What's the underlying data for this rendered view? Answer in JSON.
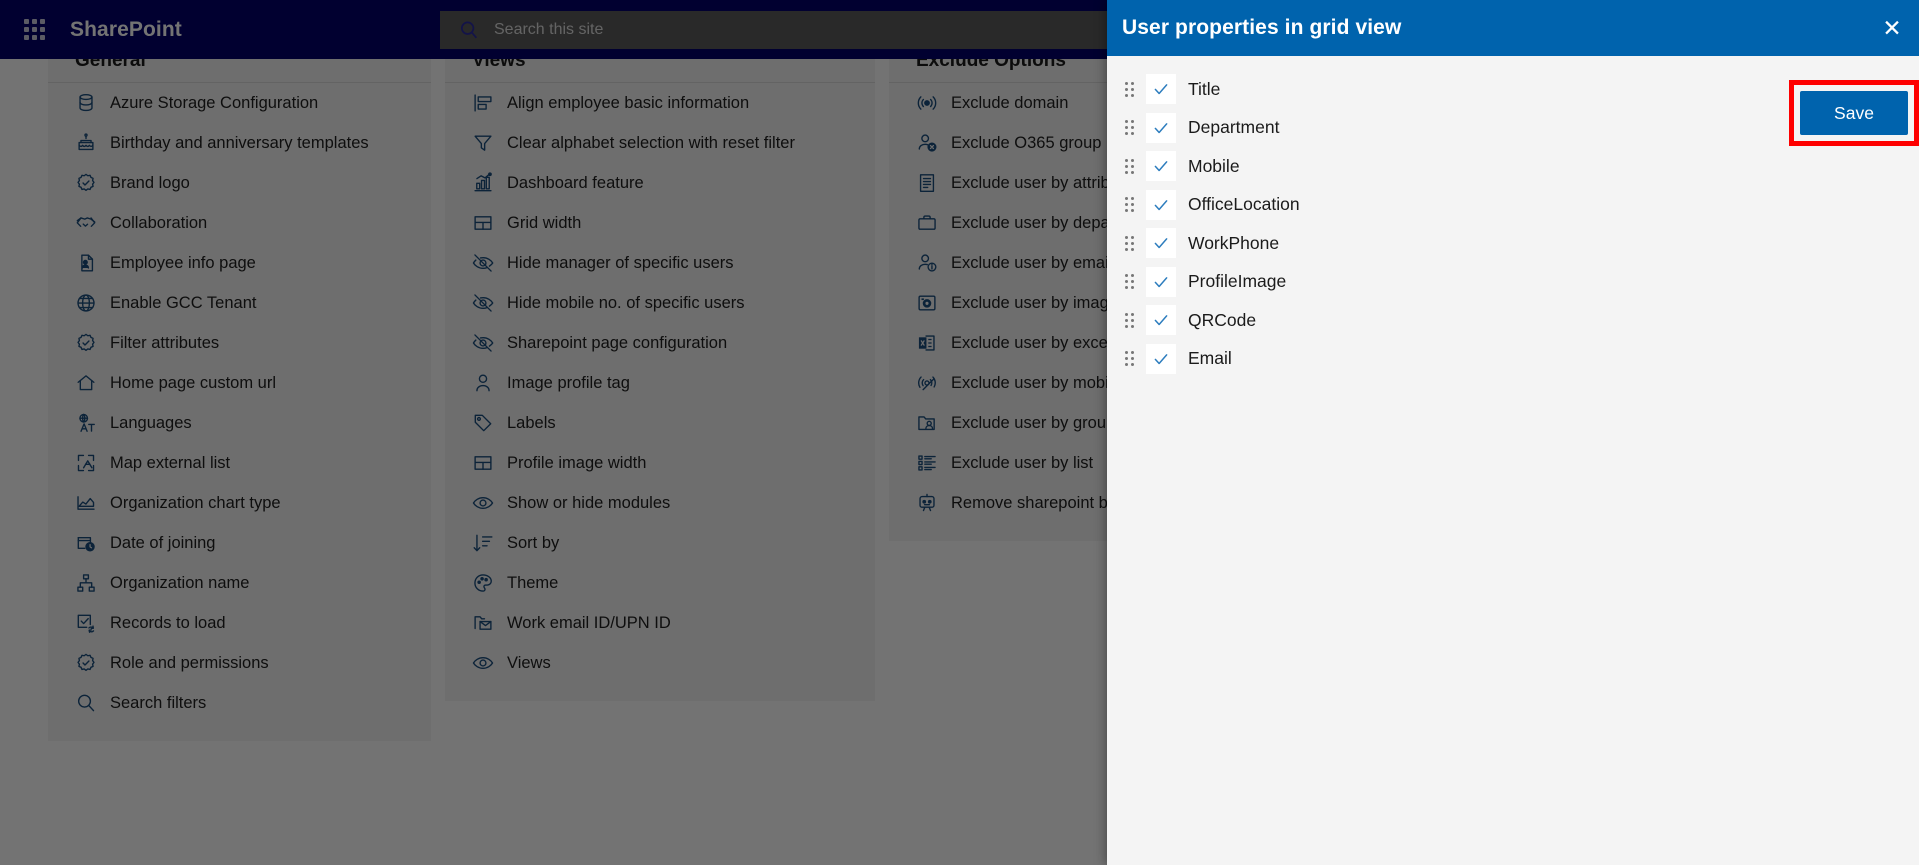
{
  "topbar": {
    "waffle_icon": "app-launcher-icon",
    "brand": "SharePoint",
    "search_icon": "search-icon",
    "search_placeholder": "Search this site",
    "search_value": ""
  },
  "columns": [
    {
      "key": "general",
      "title": "General",
      "items": [
        {
          "label": "Azure Storage Configuration",
          "icon": "database-icon"
        },
        {
          "label": "Birthday and anniversary templates",
          "icon": "cake-icon"
        },
        {
          "label": "Brand logo",
          "icon": "badge-check-icon"
        },
        {
          "label": "Collaboration",
          "icon": "handshake-icon"
        },
        {
          "label": "Employee info page",
          "icon": "contact-card-icon"
        },
        {
          "label": "Enable GCC Tenant",
          "icon": "globe-icon"
        },
        {
          "label": "Filter attributes",
          "icon": "badge-check-icon"
        },
        {
          "label": "Home page custom url",
          "icon": "home-icon"
        },
        {
          "label": "Languages",
          "icon": "translate-icon"
        },
        {
          "label": "Map external list",
          "icon": "map-pin-icon"
        },
        {
          "label": "Organization chart type",
          "icon": "area-chart-icon"
        },
        {
          "label": "Date of joining",
          "icon": "calendar-clock-icon"
        },
        {
          "label": "Organization name",
          "icon": "org-tree-icon"
        },
        {
          "label": "Records to load",
          "icon": "checkbox-refresh-icon"
        },
        {
          "label": "Role and permissions",
          "icon": "badge-check-icon"
        },
        {
          "label": "Search filters",
          "icon": "search-icon"
        }
      ]
    },
    {
      "key": "views",
      "title": "Views",
      "items": [
        {
          "label": "Align employee basic information",
          "icon": "align-left-icon"
        },
        {
          "label": "Clear alphabet selection with reset filter",
          "icon": "funnel-icon"
        },
        {
          "label": "Dashboard feature",
          "icon": "bar-chart-icon"
        },
        {
          "label": "Grid width",
          "icon": "grid-layout-icon"
        },
        {
          "label": "Hide manager of specific users",
          "icon": "eye-off-icon"
        },
        {
          "label": "Hide mobile no. of specific users",
          "icon": "eye-off-icon"
        },
        {
          "label": "Sharepoint page configuration",
          "icon": "eye-off-icon"
        },
        {
          "label": "Image profile tag",
          "icon": "person-icon"
        },
        {
          "label": "Labels",
          "icon": "tag-icon"
        },
        {
          "label": "Profile image width",
          "icon": "grid-layout-icon"
        },
        {
          "label": "Show or hide modules",
          "icon": "eye-icon"
        },
        {
          "label": "Sort by",
          "icon": "sort-descending-icon"
        },
        {
          "label": "Theme",
          "icon": "palette-icon"
        },
        {
          "label": "Work email ID/UPN ID",
          "icon": "mail-folder-icon"
        },
        {
          "label": "Views",
          "icon": "eye-icon"
        }
      ]
    },
    {
      "key": "exclude",
      "title": "Exclude Options",
      "items": [
        {
          "label": "Exclude domain",
          "icon": "broadcast-icon"
        },
        {
          "label": "Exclude O365 group",
          "icon": "person-block-icon"
        },
        {
          "label": "Exclude user by attribute",
          "icon": "document-list-icon"
        },
        {
          "label": "Exclude user by department",
          "icon": "briefcase-icon"
        },
        {
          "label": "Exclude user by email",
          "icon": "person-info-icon"
        },
        {
          "label": "Exclude user by image",
          "icon": "photo-icon"
        },
        {
          "label": "Exclude user by excel",
          "icon": "excel-icon"
        },
        {
          "label": "Exclude user by mobile",
          "icon": "broadcast-off-icon"
        },
        {
          "label": "Exclude user by group",
          "icon": "folder-person-icon"
        },
        {
          "label": "Exclude user by list",
          "icon": "list-icon"
        },
        {
          "label": "Remove sharepoint bot",
          "icon": "bot-icon"
        }
      ]
    }
  ],
  "panel": {
    "title": "User properties in grid view",
    "close_icon": "close-icon",
    "save_label": "Save",
    "highlight_color": "#fe0000",
    "accent_color": "#0063ad",
    "properties": [
      {
        "label": "Title",
        "checked": true
      },
      {
        "label": "Department",
        "checked": true
      },
      {
        "label": "Mobile",
        "checked": true
      },
      {
        "label": "OfficeLocation",
        "checked": true
      },
      {
        "label": "WorkPhone",
        "checked": true
      },
      {
        "label": "ProfileImage",
        "checked": true
      },
      {
        "label": "QRCode",
        "checked": true
      },
      {
        "label": "Email",
        "checked": true
      }
    ]
  }
}
